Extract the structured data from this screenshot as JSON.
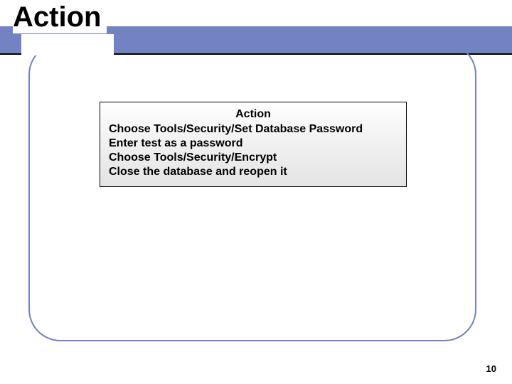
{
  "slide": {
    "title": "Action",
    "page_number": "10"
  },
  "action_box": {
    "heading": "Action",
    "lines": [
      "Choose Tools/Security/Set Database Password",
      "Enter test as a password",
      "Choose Tools/Security/Encrypt",
      "Close the database and reopen it"
    ]
  }
}
